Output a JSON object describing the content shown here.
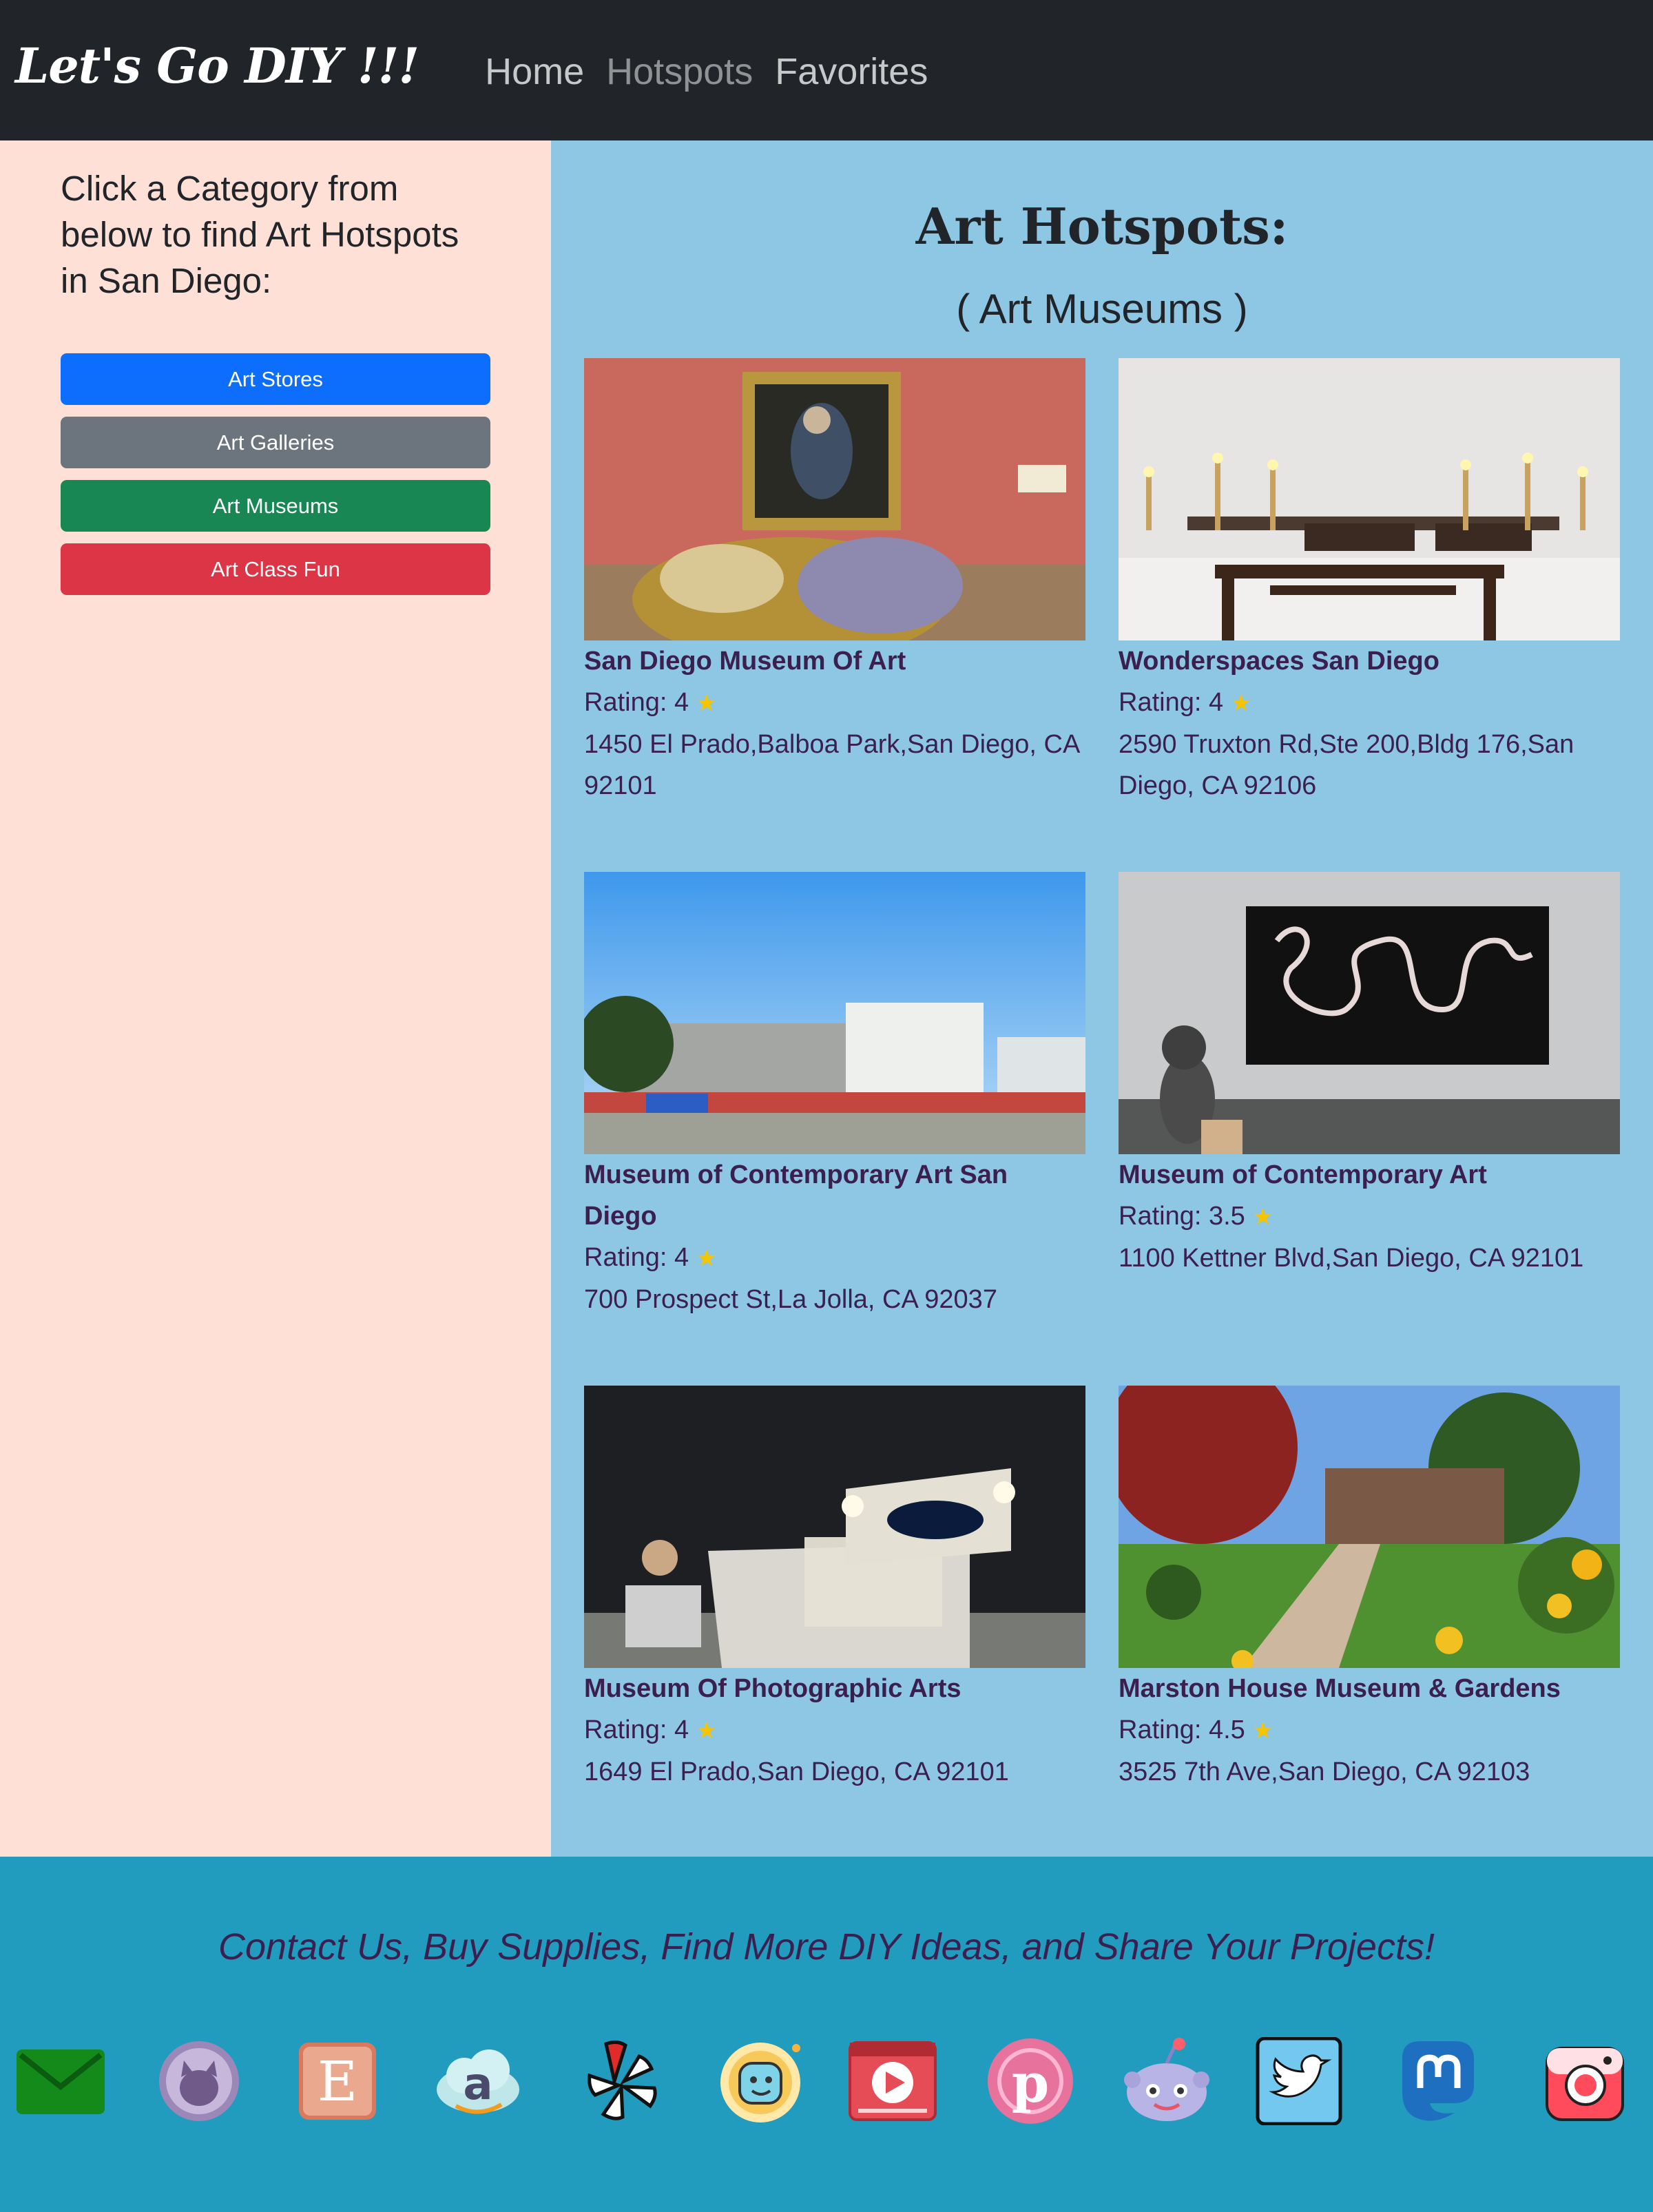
{
  "nav": {
    "brand": "Let's Go DIY !!!",
    "links": [
      "Home",
      "Hotspots",
      "Favorites"
    ]
  },
  "sidebar": {
    "heading": "Click a Category from below to find Art Hotspots in San Diego:",
    "buttons": [
      {
        "label": "Art Stores",
        "color": "#0d6efd"
      },
      {
        "label": "Art Galleries",
        "color": "#6c757d"
      },
      {
        "label": "Art Museums",
        "color": "#198754"
      },
      {
        "label": "Art Class Fun",
        "color": "#dc3545"
      }
    ]
  },
  "main": {
    "title": "Art Hotspots:",
    "subtitle": "( Art Museums )",
    "cards": [
      {
        "name": "San Diego Museum Of Art",
        "rating": "Rating: 4",
        "address": "1450 El Prado,Balboa Park,San Diego, CA 92101"
      },
      {
        "name": "Wonderspaces San Diego",
        "rating": "Rating: 4",
        "address": "2590 Truxton Rd,Ste 200,Bldg 176,San Diego, CA 92106"
      },
      {
        "name": "Museum of Contemporary Art San Diego",
        "rating": "Rating: 4",
        "address": "700 Prospect St,La Jolla, CA 92037"
      },
      {
        "name": "Museum of Contemporary Art",
        "rating": "Rating: 3.5",
        "address": "1100 Kettner Blvd,San Diego, CA 92101"
      },
      {
        "name": "Museum Of Photographic Arts",
        "rating": "Rating: 4",
        "address": "1649 El Prado,San Diego, CA 92101"
      },
      {
        "name": "Marston House Museum & Gardens",
        "rating": "Rating: 4.5",
        "address": "3525 7th Ave,San Diego, CA 92103"
      }
    ],
    "star_glyph": "★"
  },
  "footer": {
    "text": "Contact Us, Buy Supplies, Find More DIY Ideas, and Share Your Projects!",
    "icons": [
      "email-icon",
      "github-icon",
      "etsy-icon",
      "amazon-icon",
      "yelp-icon",
      "waze-icon",
      "youtube-icon",
      "pinterest-icon",
      "reddit-icon",
      "twitter-icon",
      "mastodon-icon",
      "instagram-icon"
    ],
    "etsy_letter": "E",
    "amazon_letter": "a"
  }
}
